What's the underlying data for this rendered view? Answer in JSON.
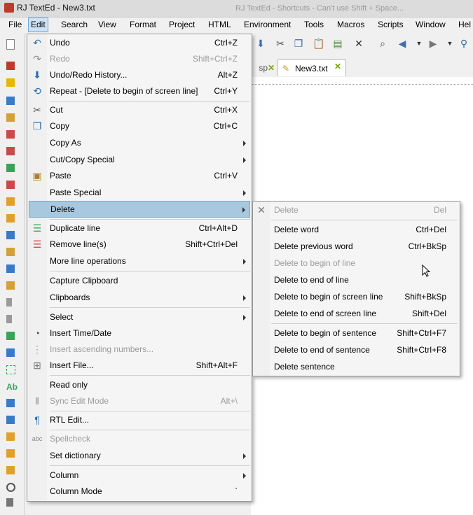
{
  "window": {
    "title": "RJ TextEd - New3.txt",
    "background_title": "RJ TextEd - Shortcuts - Can't use Shift + Space..."
  },
  "menubar": {
    "items": [
      "File",
      "Edit",
      "Search",
      "View",
      "Format",
      "Project",
      "HTML",
      "Environment",
      "Tools",
      "Macros",
      "Scripts",
      "Window",
      "Hel"
    ]
  },
  "tabs": {
    "partial_label": "sp",
    "current_label": "New3.txt"
  },
  "edit_menu": [
    {
      "label": "Undo",
      "shortcut": "Ctrl+Z",
      "icon": "undo-icon",
      "enabled": true
    },
    {
      "label": "Redo",
      "shortcut": "Shift+Ctrl+Z",
      "icon": "redo-icon",
      "enabled": false
    },
    {
      "label": "Undo/Redo History...",
      "shortcut": "Alt+Z",
      "icon": "history-icon",
      "enabled": true
    },
    {
      "label": "Repeat - [Delete to begin of screen line]",
      "shortcut": "Ctrl+Y",
      "icon": "repeat-icon",
      "enabled": true
    },
    {
      "label": "Cut",
      "shortcut": "Ctrl+X",
      "icon": "cut-icon",
      "enabled": true
    },
    {
      "label": "Copy",
      "shortcut": "Ctrl+C",
      "icon": "copy-icon",
      "enabled": true
    },
    {
      "label": "Copy As",
      "shortcut": "",
      "submenu": true,
      "enabled": true
    },
    {
      "label": "Cut/Copy Special",
      "shortcut": "",
      "submenu": true,
      "enabled": true
    },
    {
      "label": "Paste",
      "shortcut": "Ctrl+V",
      "icon": "paste-icon",
      "enabled": true
    },
    {
      "label": "Paste Special",
      "shortcut": "",
      "submenu": true,
      "enabled": true
    },
    {
      "label": "Delete",
      "shortcut": "",
      "submenu": true,
      "enabled": true,
      "highlight": true
    },
    {
      "label": "Duplicate line",
      "shortcut": "Ctrl+Alt+D",
      "icon": "duplicate-line-icon",
      "enabled": true
    },
    {
      "label": "Remove line(s)",
      "shortcut": "Shift+Ctrl+Del",
      "icon": "remove-line-icon",
      "enabled": true
    },
    {
      "label": "More line operations",
      "shortcut": "",
      "submenu": true,
      "enabled": true
    },
    {
      "label": "Capture Clipboard",
      "shortcut": "",
      "enabled": true
    },
    {
      "label": "Clipboards",
      "shortcut": "",
      "submenu": true,
      "enabled": true
    },
    {
      "label": "Select",
      "shortcut": "",
      "submenu": true,
      "enabled": true
    },
    {
      "label": "Insert Time/Date",
      "shortcut": "",
      "icon": "clock-icon",
      "enabled": true
    },
    {
      "label": "Insert ascending numbers...",
      "shortcut": "",
      "icon": "numbers-icon",
      "enabled": false
    },
    {
      "label": "Insert File...",
      "shortcut": "Shift+Alt+F",
      "icon": "insert-file-icon",
      "enabled": true
    },
    {
      "label": "Read only",
      "shortcut": "",
      "enabled": true
    },
    {
      "label": "Sync Edit Mode",
      "shortcut": "Alt+\\",
      "icon": "sync-edit-icon",
      "enabled": false
    },
    {
      "label": "RTL Edit...",
      "shortcut": "",
      "icon": "rtl-icon",
      "enabled": true
    },
    {
      "label": "Spellcheck",
      "shortcut": "",
      "icon": "spellcheck-icon",
      "enabled": false
    },
    {
      "label": "Set dictionary",
      "shortcut": "",
      "submenu": true,
      "enabled": true
    },
    {
      "label": "Column",
      "shortcut": "",
      "submenu": true,
      "enabled": true
    },
    {
      "label": "Column Mode",
      "shortcut": "`",
      "enabled": true
    }
  ],
  "delete_menu": [
    {
      "label": "Delete",
      "shortcut": "Del",
      "icon": "delete-x-icon",
      "enabled": false
    },
    {
      "label": "Delete word",
      "shortcut": "Ctrl+Del",
      "enabled": true
    },
    {
      "label": "Delete previous word",
      "shortcut": "Ctrl+BkSp",
      "enabled": true
    },
    {
      "label": "Delete to begin of line",
      "shortcut": "",
      "enabled": false
    },
    {
      "label": "Delete to end of line",
      "shortcut": "",
      "enabled": true
    },
    {
      "label": "Delete to begin of screen line",
      "shortcut": "Shift+BkSp",
      "enabled": true
    },
    {
      "label": "Delete to end of screen line",
      "shortcut": "Shift+Del",
      "enabled": true
    },
    {
      "label": "Delete to begin of sentence",
      "shortcut": "Shift+Ctrl+F7",
      "enabled": true
    },
    {
      "label": "Delete to end of sentence",
      "shortcut": "Shift+Ctrl+F8",
      "enabled": true
    },
    {
      "label": "Delete sentence",
      "shortcut": "",
      "enabled": true
    }
  ]
}
